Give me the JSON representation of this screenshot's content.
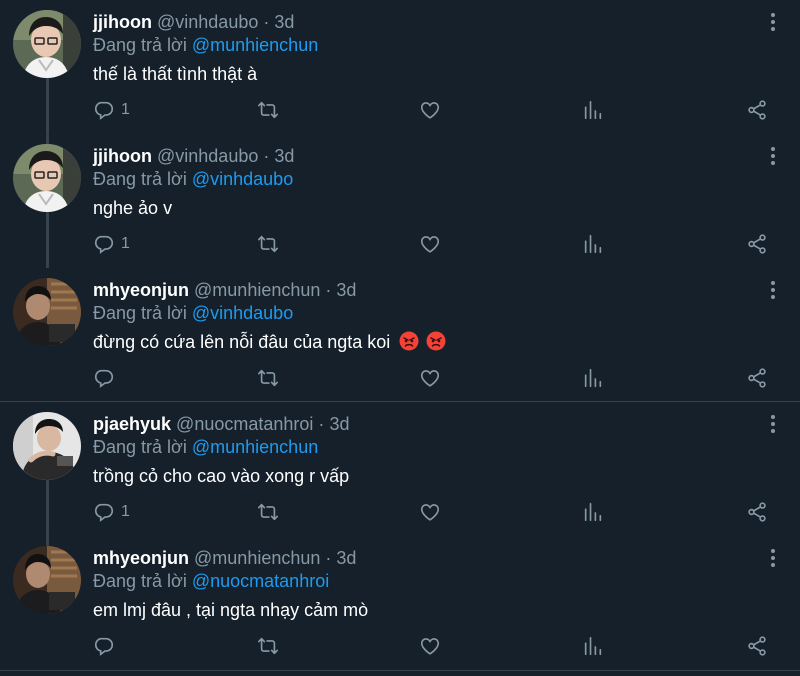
{
  "tweets": [
    {
      "name": "jjihoon",
      "handle": "@vinhdaubo",
      "dot": "·",
      "time": "3d",
      "reply_prefix": "Đang trả lời",
      "reply_to": "@munhienchun",
      "text": "thế là thất tình thật à",
      "reply_count": "1",
      "avatar": "avatar-jjihoon"
    },
    {
      "name": "jjihoon",
      "handle": "@vinhdaubo",
      "dot": "·",
      "time": "3d",
      "reply_prefix": "Đang trả lời",
      "reply_to": "@vinhdaubo",
      "text": "nghe ảo v",
      "reply_count": "1",
      "avatar": "avatar-jjihoon"
    },
    {
      "name": "mhyeonjun",
      "handle": "@munhienchun",
      "dot": "·",
      "time": "3d",
      "reply_prefix": "Đang trả lời",
      "reply_to": "@vinhdaubo",
      "text": "đừng có cứa lên nỗi đâu của ngta koi",
      "reply_count": "",
      "avatar": "avatar-mhyeonjun",
      "emojis": [
        "angry-face-icon",
        "angry-face-icon"
      ]
    },
    {
      "name": "pjaehyuk",
      "handle": "@nuocmatanhroi",
      "dot": "·",
      "time": "3d",
      "reply_prefix": "Đang trả lời",
      "reply_to": "@munhienchun",
      "text": "trồng cỏ cho cao vào xong r vấp",
      "reply_count": "1",
      "avatar": "avatar-pjaehyuk"
    },
    {
      "name": "mhyeonjun",
      "handle": "@munhienchun",
      "dot": "·",
      "time": "3d",
      "reply_prefix": "Đang trả lời",
      "reply_to": "@nuocmatanhroi",
      "text": "em lmj đâu , tại ngta nhạy cảm mò",
      "reply_count": "",
      "avatar": "avatar-mhyeonjun"
    }
  ],
  "colors": {
    "background": "#15202b",
    "muted": "#8899a6",
    "accent": "#1d9bf0",
    "divider": "#38444d"
  }
}
